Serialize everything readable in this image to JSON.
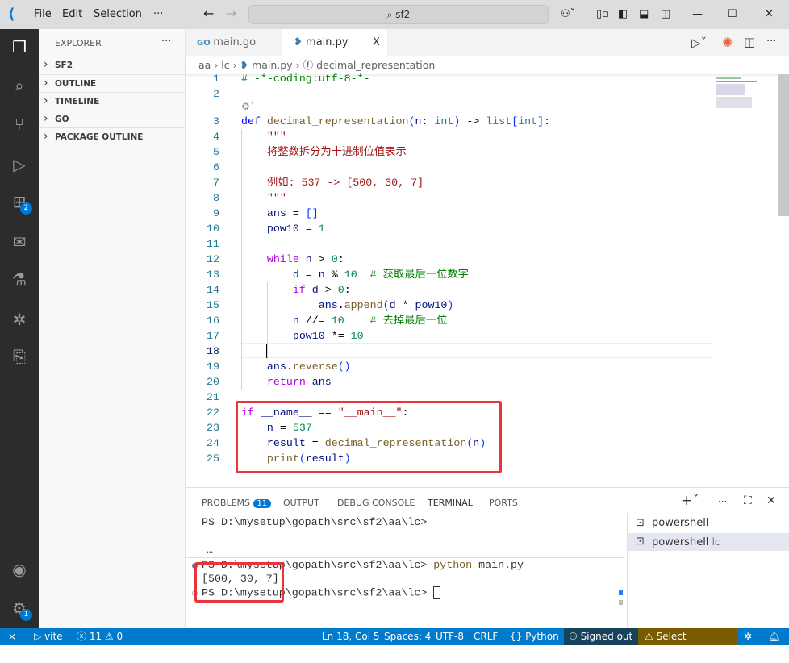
{
  "menu": {
    "file": "File",
    "edit": "Edit",
    "selection": "Selection",
    "more": "···"
  },
  "search": "sf2",
  "sidebar": {
    "title": "EXPLORER",
    "more": "···",
    "sections": [
      "SF2",
      "OUTLINE",
      "TIMELINE",
      "GO",
      "PACKAGE OUTLINE"
    ]
  },
  "activity": {
    "extensions_badge": "2",
    "settings_badge": "1"
  },
  "tabs": [
    {
      "label": "main.go",
      "icon": "go-icon"
    },
    {
      "label": "main.py",
      "icon": "python-icon",
      "close": "X"
    }
  ],
  "breadcrumb": [
    "aa",
    "lc",
    "main.py",
    "decimal_representation"
  ],
  "cursor_line": 18,
  "code": [
    {
      "n": "1",
      "tokens": [
        [
          "c",
          "# -*-coding:utf-8-*-"
        ]
      ]
    },
    {
      "n": "2",
      "tokens": []
    },
    {
      "n": "3",
      "tokens": [
        [
          "k",
          "def "
        ],
        [
          "f",
          "decimal_representation"
        ],
        [
          "b",
          "("
        ],
        [
          "v",
          "n"
        ],
        [
          "p",
          ": "
        ],
        [
          "t",
          "int"
        ],
        [
          "b",
          ")"
        ],
        [
          "p",
          " -> "
        ],
        [
          "t",
          "list"
        ],
        [
          "b",
          "["
        ],
        [
          "t",
          "int"
        ],
        [
          "b",
          "]"
        ],
        [
          "p",
          ":"
        ]
      ]
    },
    {
      "n": "4",
      "tokens": [
        [
          "s",
          "    \"\"\""
        ]
      ]
    },
    {
      "n": "5",
      "tokens": [
        [
          "s",
          "    将整数拆分为十进制位值表示"
        ]
      ]
    },
    {
      "n": "6",
      "tokens": []
    },
    {
      "n": "7",
      "tokens": [
        [
          "s",
          "    例如: 537 -> [500, 30, 7]"
        ]
      ]
    },
    {
      "n": "8",
      "tokens": [
        [
          "s",
          "    \"\"\""
        ]
      ]
    },
    {
      "n": "9",
      "tokens": [
        [
          "v",
          "    ans"
        ],
        [
          "p",
          " = "
        ],
        [
          "b",
          "[]"
        ]
      ]
    },
    {
      "n": "10",
      "tokens": [
        [
          "v",
          "    pow10"
        ],
        [
          "p",
          " = "
        ],
        [
          "n",
          "1"
        ]
      ]
    },
    {
      "n": "11",
      "tokens": []
    },
    {
      "n": "12",
      "tokens": [
        [
          "kc",
          "    while "
        ],
        [
          "v",
          "n"
        ],
        [
          "p",
          " > "
        ],
        [
          "n",
          "0"
        ],
        [
          "p",
          ":"
        ]
      ]
    },
    {
      "n": "13",
      "tokens": [
        [
          "v",
          "        d"
        ],
        [
          "p",
          " = "
        ],
        [
          "v",
          "n"
        ],
        [
          "p",
          " % "
        ],
        [
          "n",
          "10"
        ],
        [
          "c",
          "  # 获取最后一位数字"
        ]
      ]
    },
    {
      "n": "14",
      "tokens": [
        [
          "kc",
          "        if "
        ],
        [
          "v",
          "d"
        ],
        [
          "p",
          " > "
        ],
        [
          "n",
          "0"
        ],
        [
          "p",
          ":"
        ]
      ]
    },
    {
      "n": "15",
      "tokens": [
        [
          "v",
          "            ans"
        ],
        [
          "p",
          "."
        ],
        [
          "f",
          "append"
        ],
        [
          "b",
          "("
        ],
        [
          "v",
          "d"
        ],
        [
          "p",
          " * "
        ],
        [
          "v",
          "pow10"
        ],
        [
          "b",
          ")"
        ]
      ]
    },
    {
      "n": "16",
      "tokens": [
        [
          "v",
          "        n"
        ],
        [
          "p",
          " //= "
        ],
        [
          "n",
          "10"
        ],
        [
          "c",
          "    # 去掉最后一位"
        ]
      ]
    },
    {
      "n": "17",
      "tokens": [
        [
          "v",
          "        pow10"
        ],
        [
          "p",
          " *= "
        ],
        [
          "n",
          "10"
        ]
      ]
    },
    {
      "n": "18",
      "tokens": [
        [
          "p",
          "    "
        ]
      ]
    },
    {
      "n": "19",
      "tokens": [
        [
          "v",
          "    ans"
        ],
        [
          "p",
          "."
        ],
        [
          "f",
          "reverse"
        ],
        [
          "b",
          "()"
        ]
      ]
    },
    {
      "n": "20",
      "tokens": [
        [
          "kc",
          "    return "
        ],
        [
          "v",
          "ans"
        ]
      ]
    },
    {
      "n": "21",
      "tokens": []
    },
    {
      "n": "22",
      "tokens": [
        [
          "kc",
          "if "
        ],
        [
          "v",
          "__name__"
        ],
        [
          "p",
          " == "
        ],
        [
          "s",
          "\"__main__\""
        ],
        [
          "p",
          ":"
        ]
      ]
    },
    {
      "n": "23",
      "tokens": [
        [
          "v",
          "    n"
        ],
        [
          "p",
          " = "
        ],
        [
          "n",
          "537"
        ]
      ]
    },
    {
      "n": "24",
      "tokens": [
        [
          "v",
          "    result"
        ],
        [
          "p",
          " = "
        ],
        [
          "f",
          "decimal_representation"
        ],
        [
          "b",
          "("
        ],
        [
          "v",
          "n"
        ],
        [
          "b",
          ")"
        ]
      ]
    },
    {
      "n": "25",
      "tokens": [
        [
          "f",
          "    print"
        ],
        [
          "b",
          "("
        ],
        [
          "v",
          "result"
        ],
        [
          "b",
          ")"
        ]
      ]
    }
  ],
  "panel": {
    "tabs": [
      "PROBLEMS",
      "OUTPUT",
      "DEBUG CONSOLE",
      "TERMINAL",
      "PORTS"
    ],
    "problems_count": "11",
    "active": "TERMINAL"
  },
  "terminal": {
    "line1": "PS D:\\mysetup\\gopath\\src\\sf2\\aa\\lc>",
    "ellipsis": "…",
    "prompt": "PS D:\\mysetup\\gopath\\src\\sf2\\aa\\lc> ",
    "cmd": "python",
    "args": " main.py",
    "output": "[500, 30, 7]",
    "prompt2": "PS D:\\mysetup\\gopath\\src\\sf2\\aa\\lc> "
  },
  "terminal_list": [
    {
      "label": "powershell",
      "suffix": ""
    },
    {
      "label": "powershell",
      "suffix": "lc"
    }
  ],
  "status": {
    "remote": "⨯",
    "vite": "vite",
    "errors": "11",
    "warnings": "0",
    "position": "Ln 18, Col 5",
    "spaces": "Spaces: 4",
    "encoding": "UTF-8",
    "eol": "CRLF",
    "language": "Python",
    "signed": "Signed out",
    "interpreter": "Select Interpreter"
  },
  "colors": {
    "accent": "#007acc",
    "highlight": "#e8353d",
    "statusbar_warn": "#7a5c00"
  }
}
